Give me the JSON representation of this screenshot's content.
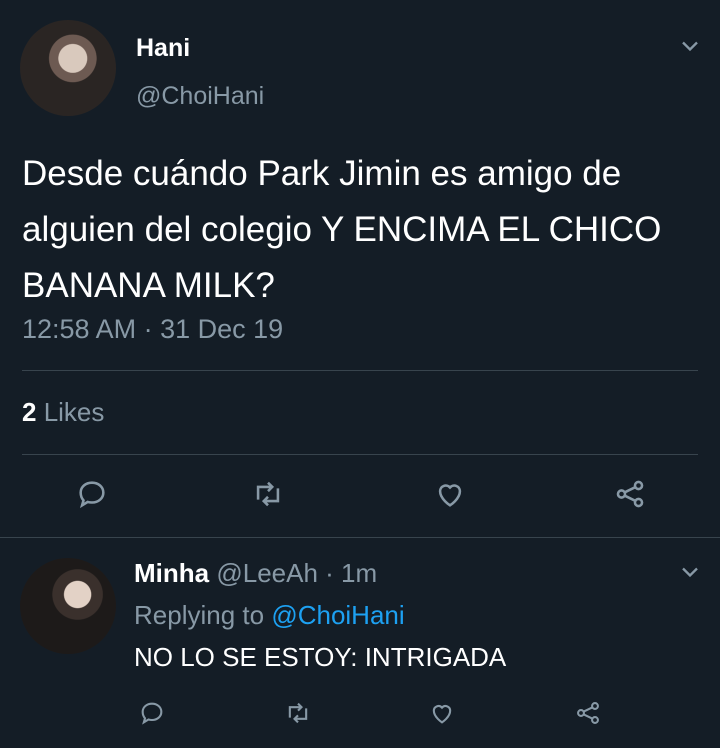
{
  "tweet": {
    "author_name": "Hani",
    "author_handle": "@ChoiHani",
    "text": "Desde cuándo Park Jimin es amigo de alguien del colegio Y ENCIMA EL CHICO BANANA MILK?",
    "timestamp": "12:58 AM · 31 Dec 19",
    "likes_count": "2",
    "likes_label": " Likes",
    "avatar_icon": "profile-photo"
  },
  "reply": {
    "author_name": "Minha",
    "author_handle": "@LeeAh",
    "separator": " · ",
    "time": "1m",
    "replying_prefix": "Replying to ",
    "replying_to": "@ChoiHani",
    "text": "NO LO SE ESTOY: INTRIGADA",
    "avatar_icon": "profile-photo"
  },
  "actions": [
    "reply-icon",
    "retweet-icon",
    "like-icon",
    "share-icon"
  ],
  "colors": {
    "background": "#141d26",
    "text": "#ffffff",
    "muted": "#8899a6",
    "link": "#1da1f2",
    "divider": "#38444d"
  }
}
